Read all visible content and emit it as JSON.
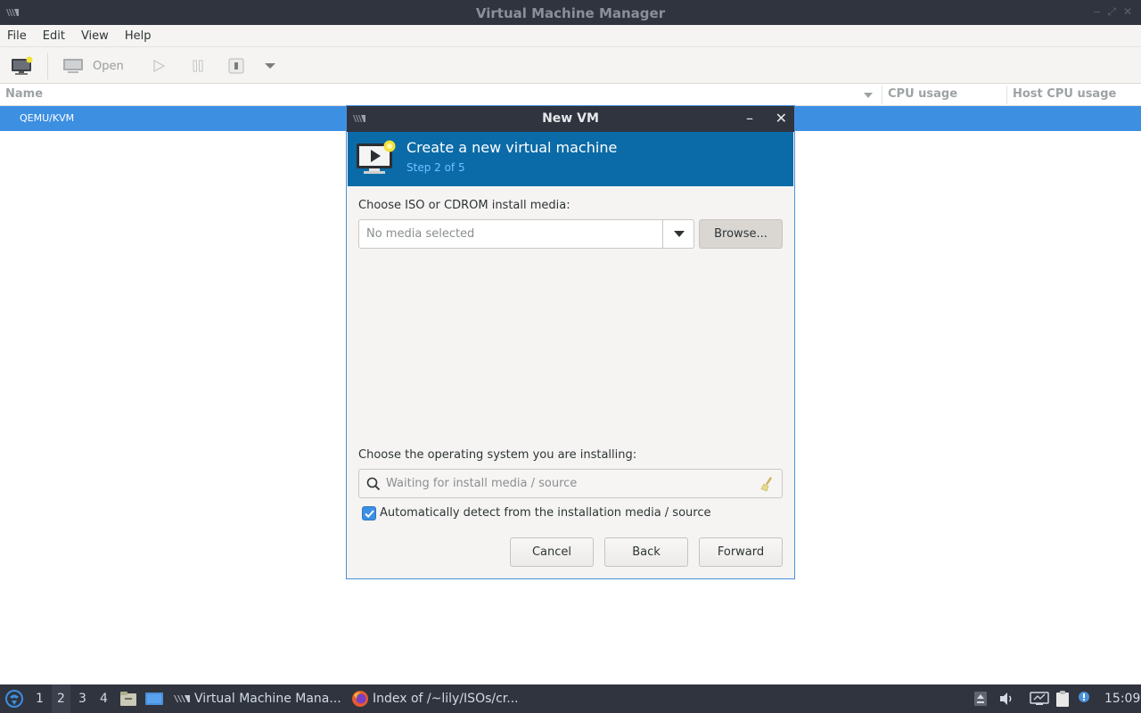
{
  "window": {
    "title": "Virtual Machine Manager"
  },
  "menu": [
    "File",
    "Edit",
    "View",
    "Help"
  ],
  "toolbar": {
    "open_label": "Open"
  },
  "list": {
    "columns": [
      "Name",
      "CPU usage",
      "Host CPU usage"
    ],
    "rows": [
      "QEMU/KVM"
    ]
  },
  "dialog": {
    "title": "New VM",
    "heading": "Create a new virtual machine",
    "step": "Step 2 of 5",
    "media_label": "Choose ISO or CDROM install media:",
    "media_placeholder": "No media selected",
    "browse_label": "Browse...",
    "os_label": "Choose the operating system you are installing:",
    "os_placeholder": "Waiting for install media / source",
    "auto_detect_label": "Automatically detect from the installation media / source",
    "auto_detect_checked": true,
    "cancel_label": "Cancel",
    "back_label": "Back",
    "forward_label": "Forward"
  },
  "taskbar": {
    "workspaces": [
      "1",
      "2",
      "3",
      "4"
    ],
    "active_workspace": "2",
    "tasks": [
      "Virtual Machine Mana...",
      "Index of /~lily/ISOs/cr..."
    ],
    "clock": "15:09"
  },
  "colors": {
    "selection": "#3d8fe2",
    "banner": "#0b6ba8",
    "titlebar": "#2f343f"
  }
}
